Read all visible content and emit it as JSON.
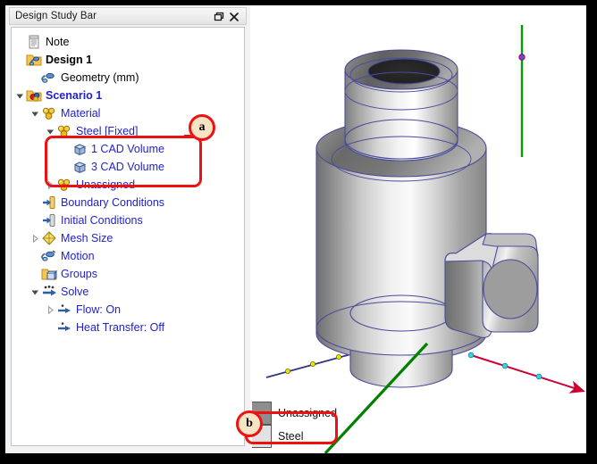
{
  "window": {
    "title": "Design Study Bar",
    "buttons": [
      {
        "name": "dock-icon",
        "label": "Dock"
      },
      {
        "name": "close-icon",
        "label": "Close"
      }
    ]
  },
  "tree": {
    "items": [
      {
        "id": "note",
        "label": "Note",
        "depth": 0,
        "icon": "note-icon",
        "expander": "none",
        "bold": false,
        "color": "black"
      },
      {
        "id": "design-1",
        "label": "Design 1",
        "depth": 0,
        "icon": "design-icon",
        "expander": "none",
        "bold": true,
        "color": "black"
      },
      {
        "id": "geometry",
        "label": "Geometry (mm)",
        "depth": 1,
        "icon": "geometry-icon",
        "expander": "none",
        "bold": false,
        "color": "black"
      },
      {
        "id": "scenario-1",
        "label": "Scenario 1",
        "depth": 0,
        "icon": "scenario-icon",
        "expander": "expanded",
        "bold": true,
        "color": "blue"
      },
      {
        "id": "material",
        "label": "Material",
        "depth": 1,
        "icon": "material-icon",
        "expander": "expanded",
        "bold": false,
        "color": "blue"
      },
      {
        "id": "steel-fixed",
        "label": "Steel [Fixed]",
        "depth": 2,
        "icon": "material-icon",
        "expander": "expanded",
        "bold": false,
        "color": "blue"
      },
      {
        "id": "cad-volume-1",
        "label": "1 CAD Volume",
        "depth": 3,
        "icon": "cad-volume-icon",
        "expander": "none",
        "bold": false,
        "color": "blue"
      },
      {
        "id": "cad-volume-3",
        "label": "3 CAD Volume",
        "depth": 3,
        "icon": "cad-volume-icon",
        "expander": "none",
        "bold": false,
        "color": "blue"
      },
      {
        "id": "unassigned",
        "label": "Unassigned",
        "depth": 2,
        "icon": "material-icon",
        "expander": "collapsed",
        "bold": false,
        "color": "blue"
      },
      {
        "id": "boundary-conditions",
        "label": "Boundary Conditions",
        "depth": 1,
        "icon": "boundary-icon",
        "expander": "none",
        "bold": false,
        "color": "blue"
      },
      {
        "id": "initial-conditions",
        "label": "Initial Conditions",
        "depth": 1,
        "icon": "initial-icon",
        "expander": "none",
        "bold": false,
        "color": "blue"
      },
      {
        "id": "mesh-size",
        "label": "Mesh Size",
        "depth": 1,
        "icon": "mesh-icon",
        "expander": "collapsed",
        "bold": false,
        "color": "blue"
      },
      {
        "id": "motion",
        "label": "Motion",
        "depth": 1,
        "icon": "motion-icon",
        "expander": "none",
        "bold": false,
        "color": "blue"
      },
      {
        "id": "groups",
        "label": "Groups",
        "depth": 1,
        "icon": "groups-icon",
        "expander": "none",
        "bold": false,
        "color": "blue"
      },
      {
        "id": "solve",
        "label": "Solve",
        "depth": 1,
        "icon": "solve-icon",
        "expander": "expanded",
        "bold": false,
        "color": "blue"
      },
      {
        "id": "flow-on",
        "label": "Flow: On",
        "depth": 2,
        "icon": "arrow-icon",
        "expander": "collapsed",
        "bold": false,
        "color": "blue"
      },
      {
        "id": "heat-transfer-off",
        "label": "Heat Transfer: Off",
        "depth": 2,
        "icon": "arrow-icon",
        "expander": "none",
        "bold": false,
        "color": "blue"
      }
    ]
  },
  "annotations": {
    "callout_a": "a",
    "callout_b": "b",
    "box_color": "#ee1111"
  },
  "legend": {
    "items": [
      {
        "label": "Unassigned",
        "swatch": "#8e8e8e"
      },
      {
        "label": "Steel",
        "swatch": "#e2e2e2"
      }
    ]
  },
  "viewport": {
    "axes": [
      {
        "name": "x-axis",
        "color": "#cc0033"
      },
      {
        "name": "y-axis",
        "color": "#008000"
      },
      {
        "name": "z-axis",
        "color": "#333388"
      }
    ],
    "model": {
      "name": "cylindrical-part",
      "edge_color": "#4b4b9b"
    }
  }
}
